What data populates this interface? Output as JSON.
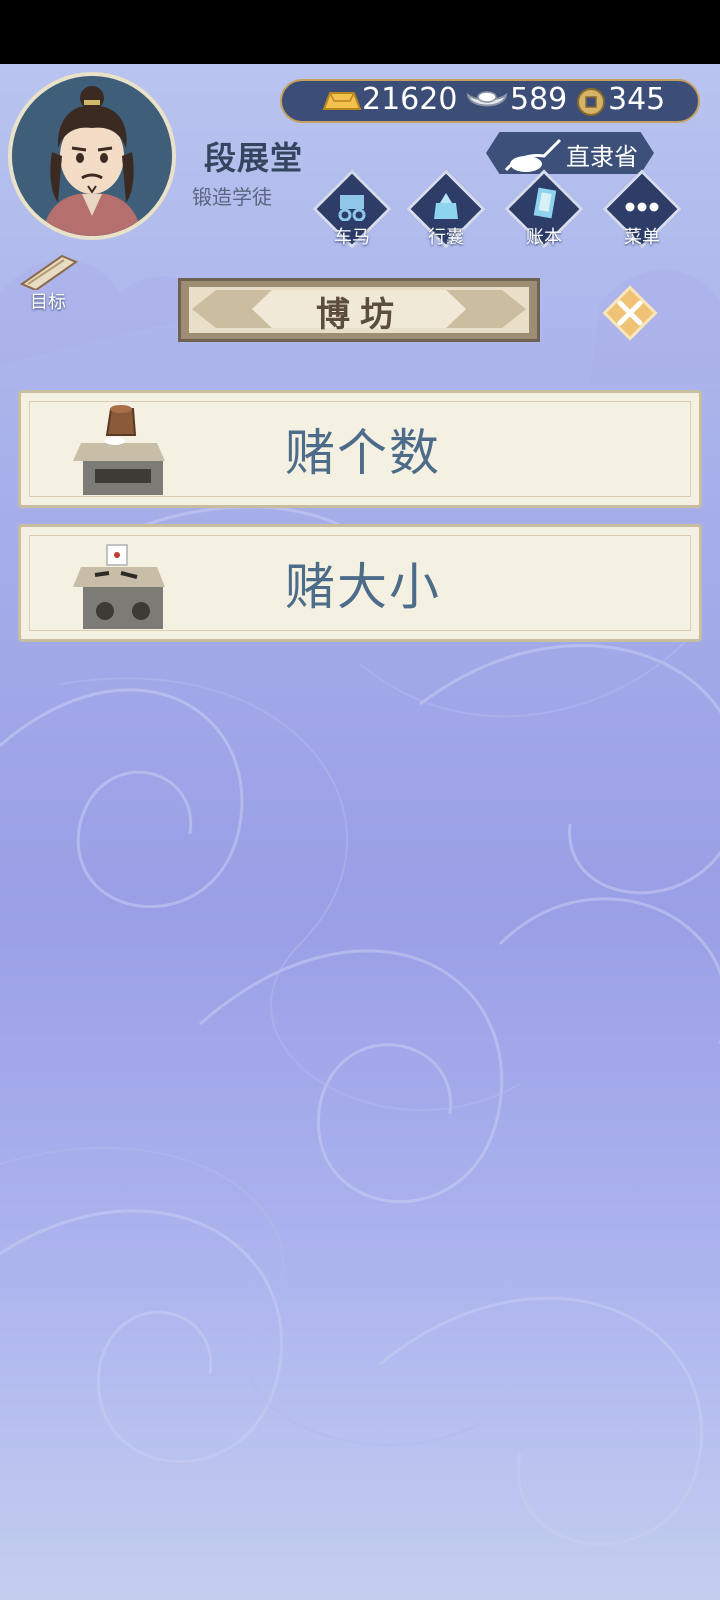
{
  "player": {
    "name": "段展堂",
    "title": "锻造学徒"
  },
  "currency": {
    "gold": "21620",
    "silver": "589",
    "coins": "345"
  },
  "location": "直隶省",
  "nav": {
    "carriage": "车马",
    "baggage": "行囊",
    "ledger": "账本",
    "menu": "菜单"
  },
  "goal": "目标",
  "screen_title": "博坊",
  "games": [
    {
      "label": "赌个数",
      "icon": "dice-cup-icon"
    },
    {
      "label": "赌大小",
      "icon": "dice-table-icon"
    }
  ],
  "colors": {
    "accent_gold": "#c5a060",
    "panel_navy": "#3c4e78",
    "card_text": "#4d6c8a"
  }
}
